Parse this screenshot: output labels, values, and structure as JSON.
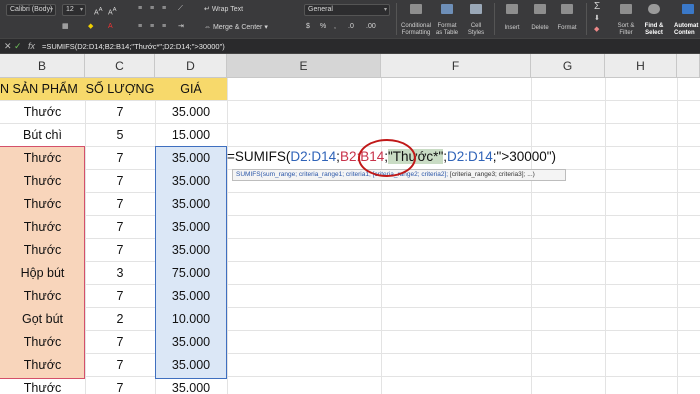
{
  "ribbon": {
    "font_name": "Calibri (Body)",
    "font_size": "12",
    "wrap_text": "Wrap Text",
    "merge_center": "Merge & Center",
    "number_format": "General",
    "conditional_formatting": [
      "Conditional",
      "Formatting"
    ],
    "format_as_table": [
      "Format",
      "as Table"
    ],
    "cell_styles": [
      "Cell",
      "Styles"
    ],
    "insert": "Insert",
    "delete": "Delete",
    "format": "Format",
    "sort_filter": [
      "Sort &",
      "Filter"
    ],
    "find_select": [
      "Find &",
      "Select"
    ],
    "automate": [
      "Automat",
      "Conten"
    ]
  },
  "formula_bar": {
    "formula": "=SUMIFS(D2:D14;B2:B14;\"Thước*\";D2:D14;\">30000\")"
  },
  "columns": [
    "B",
    "C",
    "D",
    "E",
    "F",
    "G",
    "H"
  ],
  "table": {
    "headers": [
      "N SẢN PHẨM",
      "SỐ LƯỢNG",
      "GIÁ"
    ],
    "rows": [
      [
        "Thước",
        "7",
        "35.000"
      ],
      [
        "Bút chì",
        "5",
        "15.000"
      ],
      [
        "Thước",
        "7",
        "35.000"
      ],
      [
        "Thước",
        "7",
        "35.000"
      ],
      [
        "Thước",
        "7",
        "35.000"
      ],
      [
        "Thước",
        "7",
        "35.000"
      ],
      [
        "Thước",
        "7",
        "35.000"
      ],
      [
        "Hộp bút",
        "3",
        "75.000"
      ],
      [
        "Thước",
        "7",
        "35.000"
      ],
      [
        "Gọt bút",
        "2",
        "10.000"
      ],
      [
        "Thước",
        "7",
        "35.000"
      ],
      [
        "Thước",
        "7",
        "35.000"
      ],
      [
        "Thước",
        "7",
        "35.000"
      ]
    ]
  },
  "editing_cell": {
    "prefix": "=SUMIFS(",
    "sum_range": "D2:D14",
    "sep1": ";",
    "criteria_range1": "B2:B14",
    "sep2": ";",
    "criteria1": "\"Thước*\"",
    "sep3": ";",
    "criteria_range2": "D2:D14",
    "suffix": ";\">30000\")"
  },
  "tooltip": {
    "fn": "SUMIFS(",
    "args": "sum_range; criteria_range1; criteria1; [criteria_range2; criteria2]; ",
    "rest": "[criteria_range3; criteria3]; ...)"
  },
  "colors": {
    "header_yellow": "#f7d96b",
    "range_b_fill": "#f8d5bb",
    "range_d_fill": "#dbe7f6",
    "ref_blue": "#2f63b8",
    "ref_red": "#c8324a",
    "annotation_circle": "#c01818"
  }
}
